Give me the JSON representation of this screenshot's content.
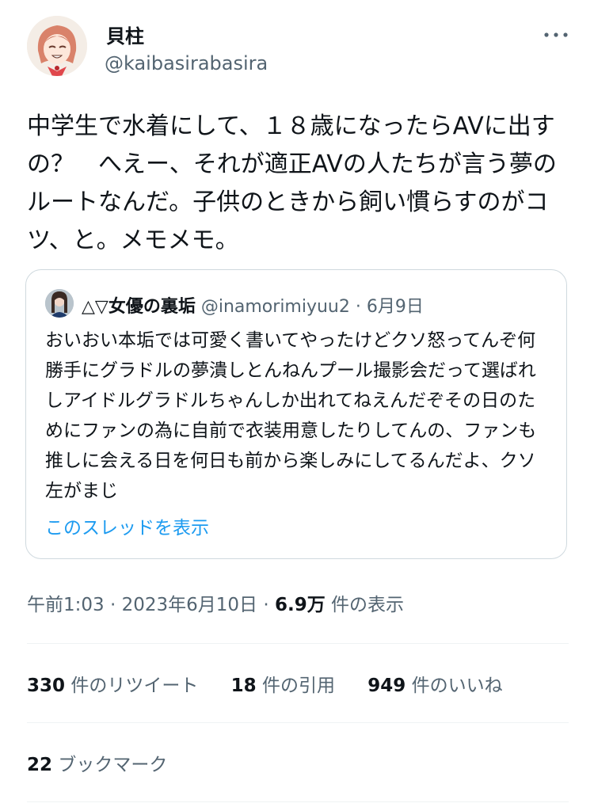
{
  "author": {
    "display_name": "貝柱",
    "handle": "@kaibasirabasira"
  },
  "tweet": {
    "text": "中学生で水着にして、１８歳になったらAVに出すの？　へえー、それが適正AVの人たちが言う夢のルートなんだ。子供のときから飼い慣らすのがコツ、と。メモメモ。"
  },
  "quote": {
    "name": "△▽女優の裏垢",
    "handle": "@inamorimiyuu2",
    "separator": " · ",
    "date": "6月9日",
    "text": "おいおい本垢では可愛く書いてやったけどクソ怒ってんぞ何勝手にグラドルの夢潰しとんねんプール撮影会だって選ばれしアイドルグラドルちゃんしか出れてねえんだぞその日のためにファンの為に自前で衣装用意したりしてんの、ファンも推しに会える日を何日も前から楽しみにしてるんだよ、クソ左がまじ",
    "show_thread": "このスレッドを表示"
  },
  "meta": {
    "time": "午前1:03",
    "sep1": " · ",
    "date": "2023年6月10日",
    "sep2": " · ",
    "views": "6.9万",
    "views_label": " 件の表示"
  },
  "stats": {
    "retweets": "330",
    "retweets_label": " 件のリツイート",
    "quotes": "18",
    "quotes_label": " 件の引用",
    "likes": "949",
    "likes_label": " 件のいいね",
    "bookmarks": "22",
    "bookmarks_label": " ブックマーク"
  },
  "icons": {
    "more": "more-dots-icon",
    "avatar": "anime-girl-avatar",
    "quote_avatar": "photo-avatar"
  },
  "colors": {
    "link": "#1d9bf0",
    "secondary_text": "#536471",
    "border": "#cfd9de"
  }
}
